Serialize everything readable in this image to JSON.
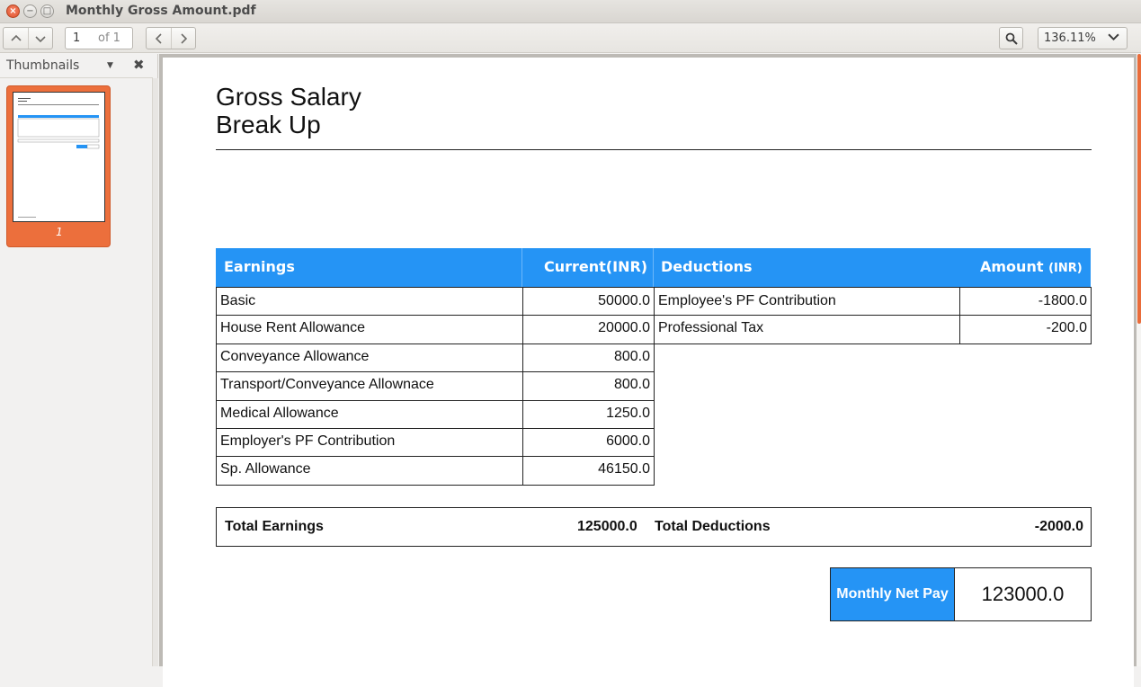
{
  "window": {
    "title": "Monthly Gross Amount.pdf",
    "close_glyph": "×",
    "min_glyph": "−",
    "max_glyph": "□"
  },
  "toolbar": {
    "current_page": "1",
    "page_total": "of 1",
    "zoom": "136.11%"
  },
  "sidebar": {
    "title": "Thumbnails",
    "thumbnail_page_number": "1"
  },
  "document": {
    "title_line1": "Gross Salary",
    "title_line2": "Break Up",
    "headers": {
      "earnings": "Earnings",
      "current": "Current(INR)",
      "deductions": "Deductions",
      "amount": "Amount",
      "amount_unit": "(INR)"
    },
    "earnings": [
      {
        "label": "Basic",
        "value": "50000.0"
      },
      {
        "label": "House Rent Allowance",
        "value": "20000.0"
      },
      {
        "label": "Conveyance Allowance",
        "value": "800.0"
      },
      {
        "label": "Transport/Conveyance Allownace",
        "value": "800.0"
      },
      {
        "label": "Medical Allowance",
        "value": "1250.0"
      },
      {
        "label": "Employer's PF Contribution",
        "value": "6000.0"
      },
      {
        "label": "Sp. Allowance",
        "value": "46150.0"
      }
    ],
    "deductions": [
      {
        "label": "Employee's PF Contribution",
        "value": "-1800.0"
      },
      {
        "label": "Professional Tax",
        "value": "-200.0"
      }
    ],
    "totals": {
      "earnings_label": "Total Earnings",
      "earnings_value": "125000.0",
      "deductions_label": "Total Deductions",
      "deductions_value": "-2000.0"
    },
    "net_pay": {
      "label": "Monthly Net Pay",
      "value": "123000.0"
    }
  },
  "colors": {
    "header_blue": "#2594f5",
    "thumbnail_orange": "#ec6f3c"
  }
}
